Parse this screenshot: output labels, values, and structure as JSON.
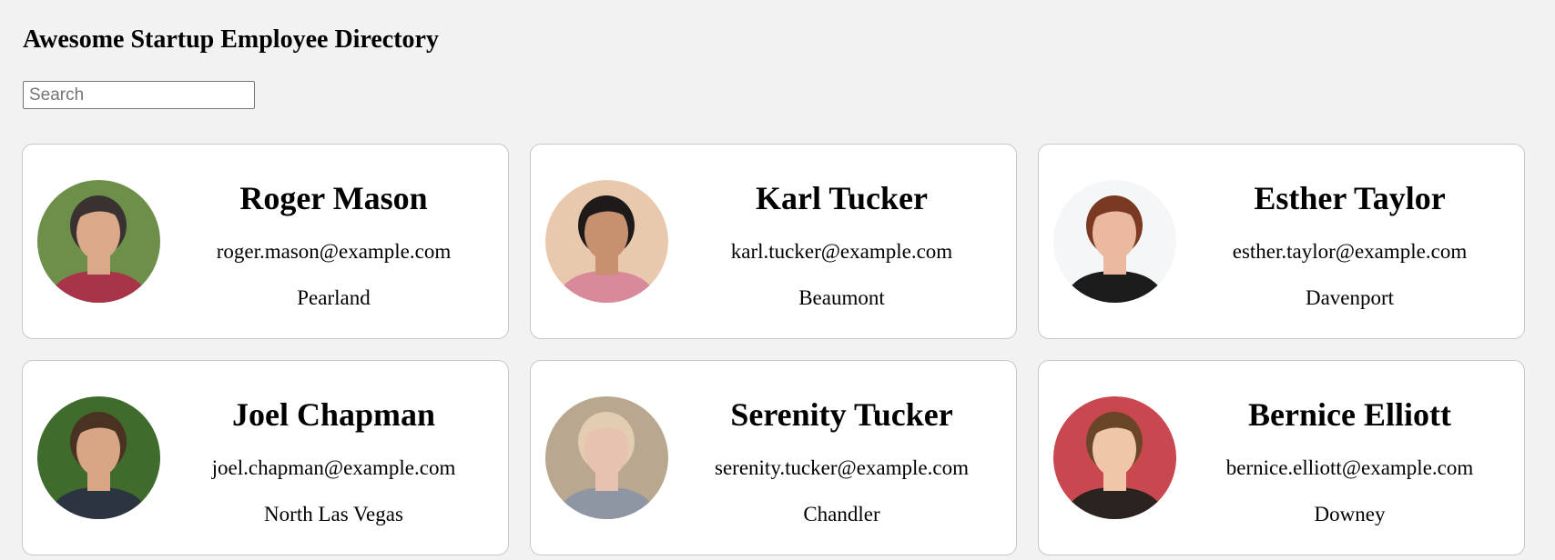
{
  "header": {
    "title": "Awesome Startup Employee Directory"
  },
  "search": {
    "placeholder": "Search",
    "value": ""
  },
  "employees": [
    {
      "name": "Roger Mason",
      "email": "roger.mason@example.com",
      "city": "Pearland",
      "photo": {
        "bg": "#6d8f4a",
        "skin": "#d9a98a",
        "hair": "#3a3230",
        "shirt": "#a8344a"
      }
    },
    {
      "name": "Karl Tucker",
      "email": "karl.tucker@example.com",
      "city": "Beaumont",
      "photo": {
        "bg": "#e9c9ae",
        "skin": "#c7906f",
        "hair": "#1e1a1a",
        "shirt": "#d98a9a"
      }
    },
    {
      "name": "Esther Taylor",
      "email": "esther.taylor@example.com",
      "city": "Davenport",
      "photo": {
        "bg": "#f4f6f7",
        "skin": "#eab9a0",
        "hair": "#7a3a22",
        "shirt": "#1c1c1c"
      }
    },
    {
      "name": "Joel Chapman",
      "email": "joel.chapman@example.com",
      "city": "North Las Vegas",
      "photo": {
        "bg": "#3f6b2c",
        "skin": "#d8a684",
        "hair": "#4a3222",
        "shirt": "#2c3440"
      }
    },
    {
      "name": "Serenity Tucker",
      "email": "serenity.tucker@example.com",
      "city": "Chandler",
      "photo": {
        "bg": "#b9a78f",
        "skin": "#e8c2b0",
        "hair": "#e3cdb0",
        "shirt": "#8e96a4"
      }
    },
    {
      "name": "Bernice Elliott",
      "email": "bernice.elliott@example.com",
      "city": "Downey",
      "photo": {
        "bg": "#c9474e",
        "skin": "#efc7a8",
        "hair": "#6b4528",
        "shirt": "#2a2320"
      }
    }
  ]
}
